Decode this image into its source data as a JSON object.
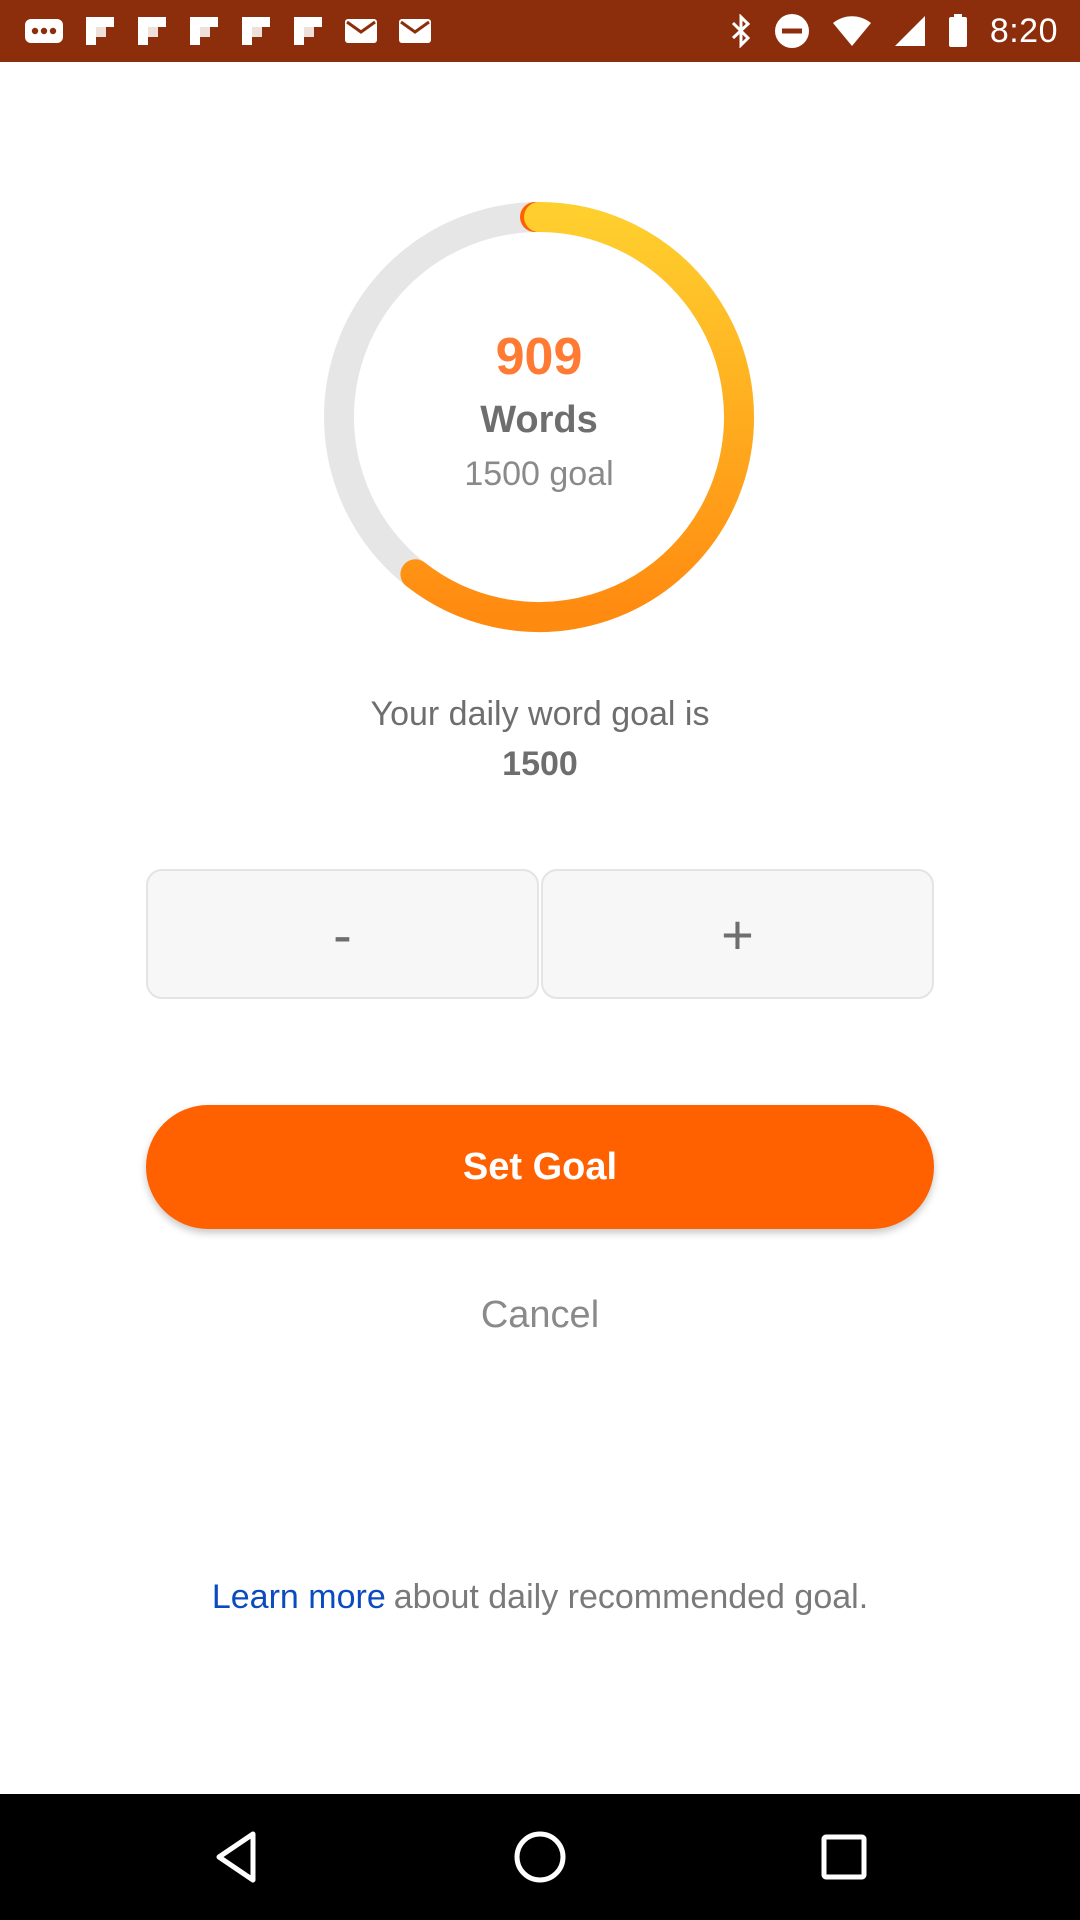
{
  "status_bar": {
    "time": "8:20",
    "background_color": "#8c2e0c",
    "left_icons": [
      "more-icon",
      "flipboard-icon",
      "flipboard-icon",
      "flipboard-icon",
      "flipboard-icon",
      "flipboard-icon",
      "mail-icon",
      "mail-icon"
    ],
    "right_icons": [
      "bluetooth-icon",
      "dnd-icon",
      "wifi-icon",
      "signal-icon",
      "battery-icon"
    ]
  },
  "progress": {
    "count": "909",
    "unit": "Words",
    "goal_label": "1500 goal",
    "current": 909,
    "goal": 1500,
    "colors": {
      "track": "#e6e6e6",
      "start": "#ff6000",
      "mid": "#ffcf2e",
      "end": "#ff8a10",
      "count_text": "#ff7a33"
    }
  },
  "goal_text": {
    "line": "Your daily word goal is",
    "value": "1500"
  },
  "stepper": {
    "minus_label": "-",
    "plus_label": "+"
  },
  "actions": {
    "set_goal_label": "Set Goal",
    "cancel_label": "Cancel",
    "accent_color": "#ff6000"
  },
  "footer": {
    "link_label": "Learn more",
    "rest_text": "about daily recommended goal.",
    "link_color": "#0b4bbf"
  },
  "nav_bar": {
    "icons": [
      "back-icon",
      "home-icon",
      "recents-icon"
    ]
  }
}
